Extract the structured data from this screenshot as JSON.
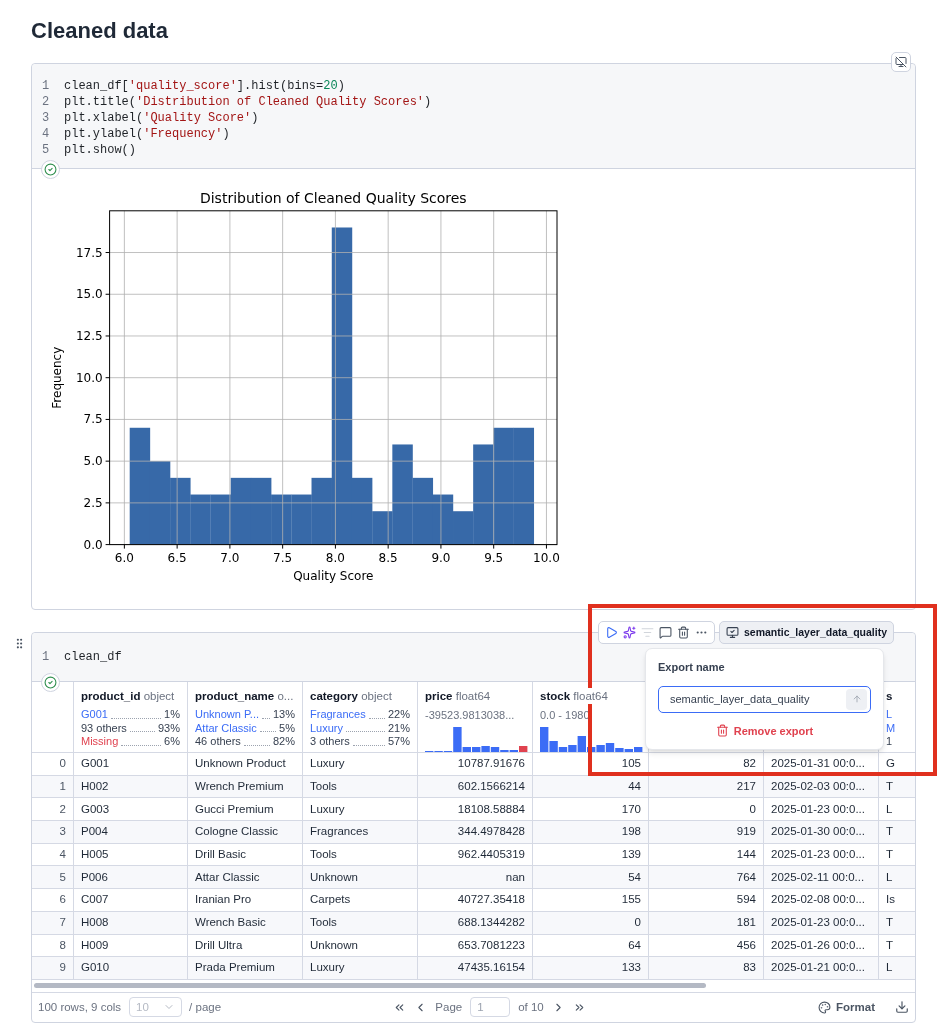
{
  "title": "Cleaned data",
  "cells": [
    {
      "kind": "chart",
      "succeeded": true,
      "code": [
        {
          "number": "1",
          "tokens": [
            {
              "kind": "plain",
              "text": "clean_df["
            },
            {
              "kind": "string",
              "text": "'quality_score'"
            },
            {
              "kind": "plain",
              "text": "].hist(bins="
            },
            {
              "kind": "number",
              "text": "20"
            },
            {
              "kind": "plain",
              "text": ")"
            }
          ]
        },
        {
          "number": "2",
          "tokens": [
            {
              "kind": "plain",
              "text": "plt.title("
            },
            {
              "kind": "string",
              "text": "'Distribution of Cleaned Quality Scores'"
            },
            {
              "kind": "plain",
              "text": ")"
            }
          ]
        },
        {
          "number": "3",
          "tokens": [
            {
              "kind": "plain",
              "text": "plt.xlabel("
            },
            {
              "kind": "string",
              "text": "'Quality Score'"
            },
            {
              "kind": "plain",
              "text": ")"
            }
          ]
        },
        {
          "number": "4",
          "tokens": [
            {
              "kind": "plain",
              "text": "plt.ylabel("
            },
            {
              "kind": "string",
              "text": "'Frequency'"
            },
            {
              "kind": "plain",
              "text": ")"
            }
          ]
        },
        {
          "number": "5",
          "tokens": [
            {
              "kind": "plain",
              "text": "plt.show()"
            }
          ]
        }
      ],
      "chart_data": {
        "type": "bar",
        "title": "Distribution of Cleaned Quality Scores",
        "xlabel": "Quality Score",
        "ylabel": "Frequency",
        "grid": true,
        "x": [
          6.146,
          6.337,
          6.529,
          6.72,
          6.912,
          7.103,
          7.295,
          7.486,
          7.678,
          7.869,
          8.061,
          8.252,
          8.444,
          8.635,
          8.827,
          9.018,
          9.21,
          9.401,
          9.593,
          9.784
        ],
        "values": [
          7,
          5,
          4,
          3,
          3,
          4,
          4,
          3,
          3,
          4,
          19,
          4,
          2,
          6,
          4,
          3,
          2,
          6,
          7,
          7
        ],
        "xlim": [
          5.86,
          10.1
        ],
        "ylim": [
          0,
          20
        ],
        "xticks": [
          {
            "value": 6,
            "label": "6.0"
          },
          {
            "value": 6.5,
            "label": "6.5"
          },
          {
            "value": 7,
            "label": "7.0"
          },
          {
            "value": 7.5,
            "label": "7.5"
          },
          {
            "value": 8,
            "label": "8.0"
          },
          {
            "value": 8.5,
            "label": "8.5"
          },
          {
            "value": 9,
            "label": "9.0"
          },
          {
            "value": 9.5,
            "label": "9.5"
          },
          {
            "value": 10,
            "label": "10.0"
          }
        ],
        "yticks": [
          {
            "value": 0,
            "label": "0.0"
          },
          {
            "value": 2.5,
            "label": "2.5"
          },
          {
            "value": 5,
            "label": "5.0"
          },
          {
            "value": 7.5,
            "label": "7.5"
          },
          {
            "value": 10,
            "label": "10.0"
          },
          {
            "value": 12.5,
            "label": "12.5"
          },
          {
            "value": 15,
            "label": "15.0"
          },
          {
            "value": 17.5,
            "label": "17.5"
          }
        ]
      }
    },
    {
      "kind": "table",
      "succeeded": true,
      "code": [
        {
          "number": "1",
          "tokens": [
            {
              "kind": "plain",
              "text": "clean_df"
            }
          ]
        }
      ],
      "columns": [
        {},
        {
          "name": "product_id",
          "dtype": "object",
          "summary": [
            {
              "kind": "value",
              "label": "G001",
              "share": "1%"
            },
            {
              "kind": "other",
              "label": "93 others",
              "share": "93%"
            },
            {
              "kind": "missing",
              "label": "Missing",
              "share": "6%"
            }
          ]
        },
        {
          "name": "product_name",
          "dtype": "o...",
          "summary": [
            {
              "kind": "value",
              "label": "Unknown P...",
              "share": "13%"
            },
            {
              "kind": "value",
              "label": "Attar Classic",
              "share": "5%"
            },
            {
              "kind": "other",
              "label": "46 others",
              "share": "82%"
            }
          ]
        },
        {
          "name": "category",
          "dtype": "object",
          "summary": [
            {
              "kind": "value",
              "label": "Fragrances",
              "share": "22%"
            },
            {
              "kind": "value",
              "label": "Luxury",
              "share": "21%"
            },
            {
              "kind": "other",
              "label": "3 others",
              "share": "57%"
            }
          ]
        },
        {
          "name": "price",
          "dtype": "float64",
          "range": "-39523.9813038...",
          "histogram": true
        },
        {
          "name": "stock",
          "dtype": "float64",
          "range": "0.0 - 1980",
          "histogram": true
        },
        {},
        {},
        {
          "name": "s",
          "summary": [
            {
              "kind": "value",
              "label": "L"
            },
            {
              "kind": "value",
              "label": "M"
            },
            {
              "kind": "other",
              "label": "1"
            }
          ]
        }
      ],
      "rows": [
        [
          "0",
          "G001",
          "Unknown Product",
          "Luxury",
          "10787.91676",
          "105",
          "82",
          "2025-01-31 00:0...",
          "G"
        ],
        [
          "1",
          "H002",
          "Wrench Premium",
          "Tools",
          "602.1566214",
          "44",
          "217",
          "2025-02-03 00:0...",
          "T"
        ],
        [
          "2",
          "G003",
          "Gucci Premium",
          "Luxury",
          "18108.58884",
          "170",
          "0",
          "2025-01-23 00:0...",
          "L"
        ],
        [
          "3",
          "P004",
          "Cologne Classic",
          "Fragrances",
          "344.4978428",
          "198",
          "919",
          "2025-01-30 00:0...",
          "T"
        ],
        [
          "4",
          "H005",
          "Drill Basic",
          "Tools",
          "962.4405319",
          "139",
          "144",
          "2025-01-23 00:0...",
          "T"
        ],
        [
          "5",
          "P006",
          "Attar Classic",
          "Unknown",
          "nan",
          "54",
          "764",
          "2025-02-11 00:0...",
          "L"
        ],
        [
          "6",
          "C007",
          "Iranian Pro",
          "Carpets",
          "40727.35418",
          "155",
          "594",
          "2025-02-08 00:0...",
          "Is"
        ],
        [
          "7",
          "H008",
          "Wrench Basic",
          "Tools",
          "688.1344282",
          "0",
          "181",
          "2025-01-23 00:0...",
          "T"
        ],
        [
          "8",
          "H009",
          "Drill Ultra",
          "Unknown",
          "653.7081223",
          "64",
          "456",
          "2025-01-26 00:0...",
          "T"
        ],
        [
          "9",
          "G010",
          "Prada Premium",
          "Luxury",
          "47435.16154",
          "133",
          "83",
          "2025-01-21 00:0...",
          "L"
        ]
      ],
      "footer": {
        "summary": "100 rows, 9 cols",
        "page_size": "10",
        "per_page": "/ page",
        "page_label": "Page",
        "page": "1",
        "page_total": "of 10",
        "format": "Format"
      }
    }
  ],
  "toolbar": {
    "export_badge": "semantic_layer_data_quality"
  },
  "export_popover": {
    "label": "Export name",
    "value": "semantic_layer_data_quality",
    "remove": "Remove export"
  }
}
